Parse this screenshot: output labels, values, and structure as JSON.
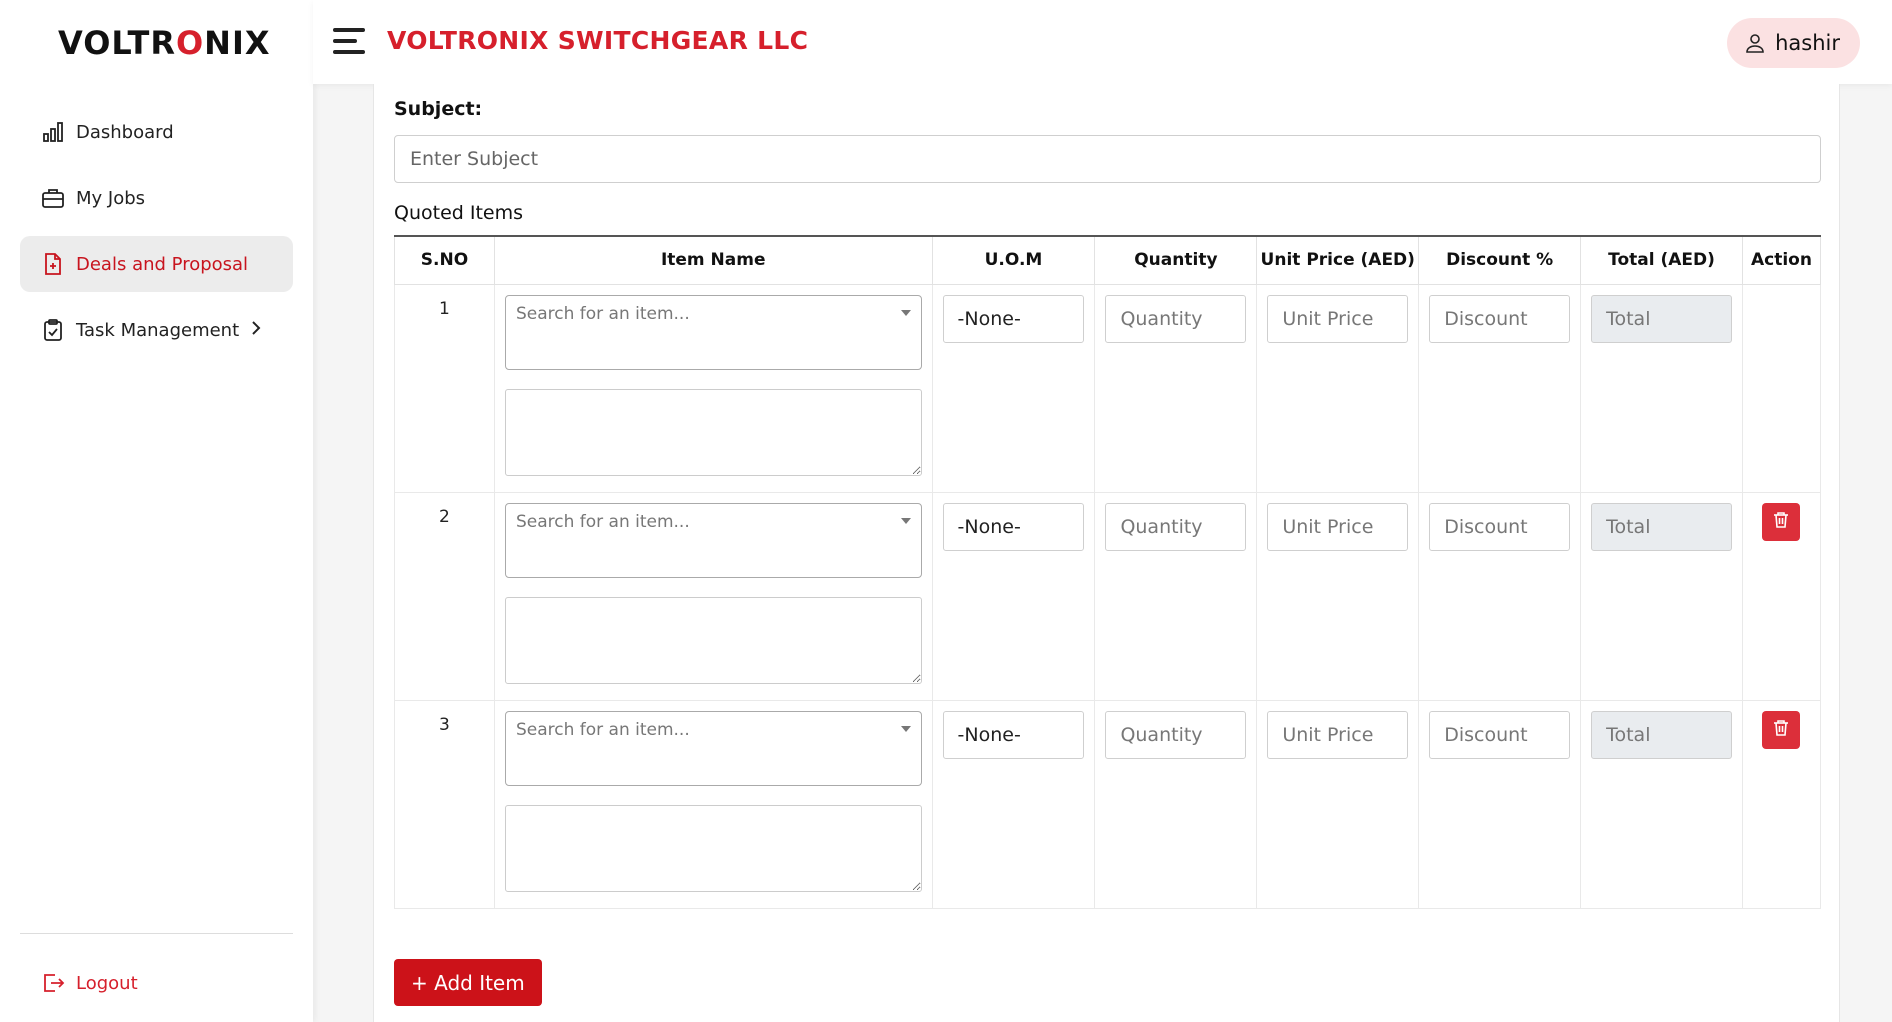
{
  "brand": {
    "logo_text_left": "VOLTR",
    "logo_text_bolt": "O",
    "logo_text_right": "NIX",
    "accent_color": "#d6202c"
  },
  "sidebar": {
    "items": [
      {
        "label": "Dashboard",
        "icon": "bar-chart-icon"
      },
      {
        "label": "My Jobs",
        "icon": "briefcase-icon"
      },
      {
        "label": "Deals and Proposal",
        "icon": "document-plus-icon",
        "active": true
      },
      {
        "label": "Task Management",
        "icon": "clipboard-check-icon"
      }
    ],
    "logout_label": "Logout"
  },
  "header": {
    "company_name": "VOLTRONIX SWITCHGEAR LLC",
    "user_name": "hashir"
  },
  "form": {
    "subject_label": "Subject:",
    "subject_placeholder": "Enter Subject",
    "quoted_items_title": "Quoted Items"
  },
  "table": {
    "columns": [
      "S.NO",
      "Item Name",
      "U.O.M",
      "Quantity",
      "Unit Price (AED)",
      "Discount %",
      "Total (AED)",
      "Action"
    ],
    "rows": [
      {
        "sno": "1",
        "item_placeholder": "Search for an item...",
        "uom": "-None-",
        "quantity_placeholder": "Quantity",
        "unit_price_placeholder": "Unit Price",
        "discount_placeholder": "Discount",
        "total_placeholder": "Total",
        "deletable": false
      },
      {
        "sno": "2",
        "item_placeholder": "Search for an item...",
        "uom": "-None-",
        "quantity_placeholder": "Quantity",
        "unit_price_placeholder": "Unit Price",
        "discount_placeholder": "Discount",
        "total_placeholder": "Total",
        "deletable": true
      },
      {
        "sno": "3",
        "item_placeholder": "Search for an item...",
        "uom": "-None-",
        "quantity_placeholder": "Quantity",
        "unit_price_placeholder": "Unit Price",
        "discount_placeholder": "Discount",
        "total_placeholder": "Total",
        "deletable": true
      }
    ]
  },
  "add_item_label": "+ Add Item"
}
